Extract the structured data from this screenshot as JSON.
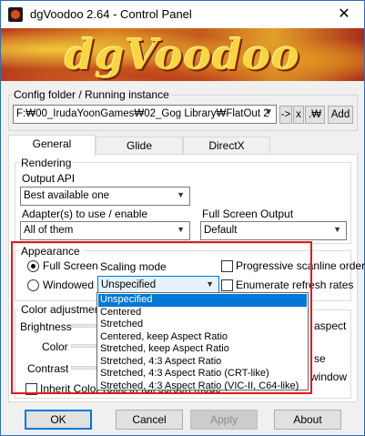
{
  "window": {
    "title": "dgVoodoo 2.64 - Control Panel",
    "close_glyph": "✕",
    "banner_text": "dgVoodoo",
    "colors": {
      "accent": "#0078d7",
      "highlight_frame": "#e81818",
      "banner": "#d8801f"
    }
  },
  "config": {
    "label": "Config folder / Running instance",
    "path_value": "F:₩00_IrudaYoonGames₩02_Gog Library₩FlatOut 2",
    "buttons": {
      "next": "->",
      "remove": "x",
      "dot": ".₩",
      "add": "Add"
    }
  },
  "tabs": [
    {
      "label": "General",
      "active": true
    },
    {
      "label": "Glide",
      "active": false
    },
    {
      "label": "DirectX",
      "active": false
    }
  ],
  "rendering": {
    "label": "Rendering",
    "output_api_label": "Output API",
    "output_api_value": "Best available one",
    "adapters_label": "Adapter(s) to use / enable",
    "adapters_value": "All of them",
    "fullscreen_output_label": "Full Screen Output",
    "fullscreen_output_value": "Default"
  },
  "appearance": {
    "label": "Appearance",
    "full_screen": "Full Screen",
    "windowed": "Windowed",
    "scaling_mode_label": "Scaling mode",
    "scaling_mode_value": "Unspecified",
    "progressive_scanline": "Progressive scanline order",
    "enumerate_refresh": "Enumerate refresh rates"
  },
  "color_adjustments": {
    "label": "Color adjustment",
    "brightness": "Brightness",
    "color": "Color",
    "contrast": "Contrast",
    "inherit_color": "Inherit Color",
    "partial_aspect": "aspect",
    "partial_se": "se",
    "partial_window": "window",
    "partial_fullscreen_mode": "Profile in full screen mode"
  },
  "scaling_dropdown": {
    "options": [
      "Unspecified",
      "Centered",
      "Stretched",
      "Centered, keep Aspect Ratio",
      "Stretched, keep Aspect Ratio",
      "Stretched, 4:3 Aspect Ratio",
      "Stretched, 4:3 Aspect Ratio (CRT-like)",
      "Stretched, 4:3 Aspect Ratio (VIC-II, C64-like)"
    ],
    "selected_index": 0
  },
  "footer": {
    "ok": "OK",
    "cancel": "Cancel",
    "apply": "Apply",
    "about": "About"
  }
}
